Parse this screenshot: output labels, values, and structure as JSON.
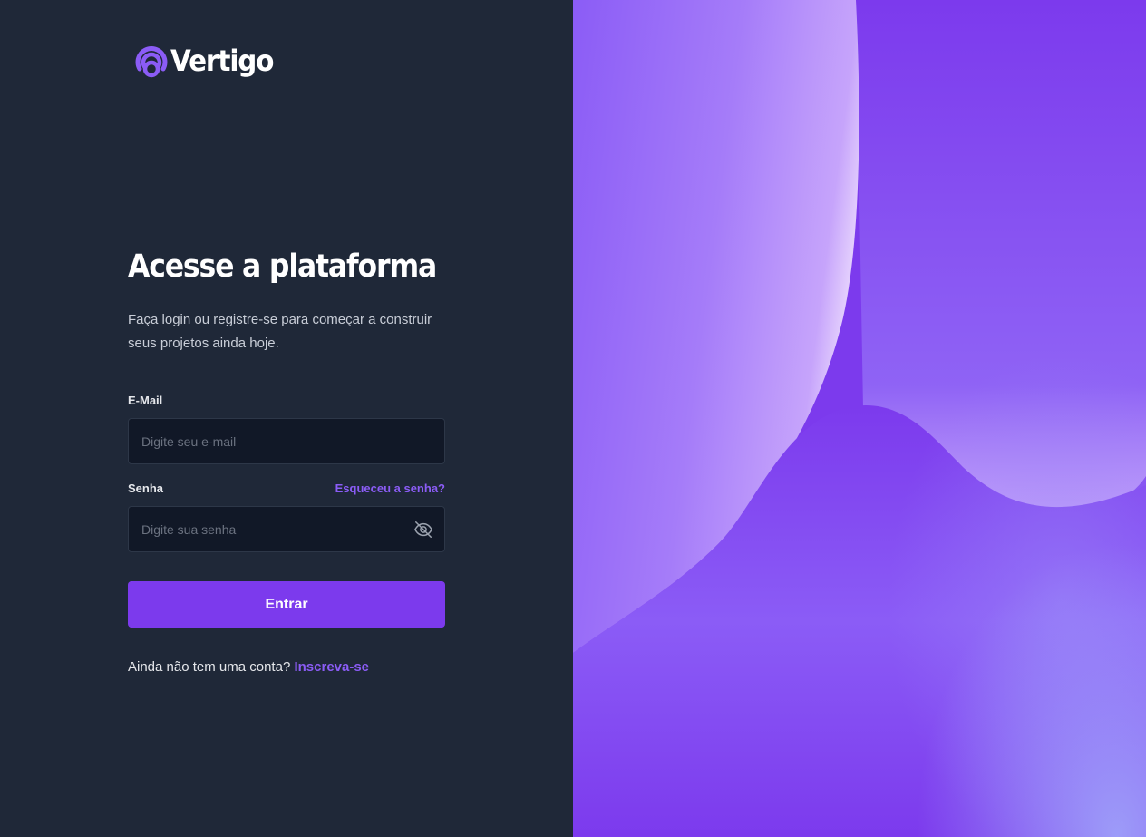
{
  "brand": {
    "name": "Vertigo",
    "logo_icon": "vertigo-signal-icon",
    "accent_color": "#7c3aed"
  },
  "login": {
    "heading": "Acesse a plataforma",
    "subtitle": "Faça login ou registre-se para começar a construir seus projetos ainda hoje.",
    "email": {
      "label": "E-Mail",
      "placeholder": "Digite seu e-mail",
      "value": ""
    },
    "password": {
      "label": "Senha",
      "placeholder": "Digite sua senha",
      "value": "",
      "forgot_label": "Esqueceu a senha?",
      "toggle_icon": "eye-off-icon"
    },
    "submit_label": "Entrar",
    "signup_prompt": "Ainda não tem uma conta?",
    "signup_label": "Inscreva-se"
  },
  "colors": {
    "left_background": "#1f2838",
    "input_background": "#111827",
    "link": "#8b5cf6"
  }
}
